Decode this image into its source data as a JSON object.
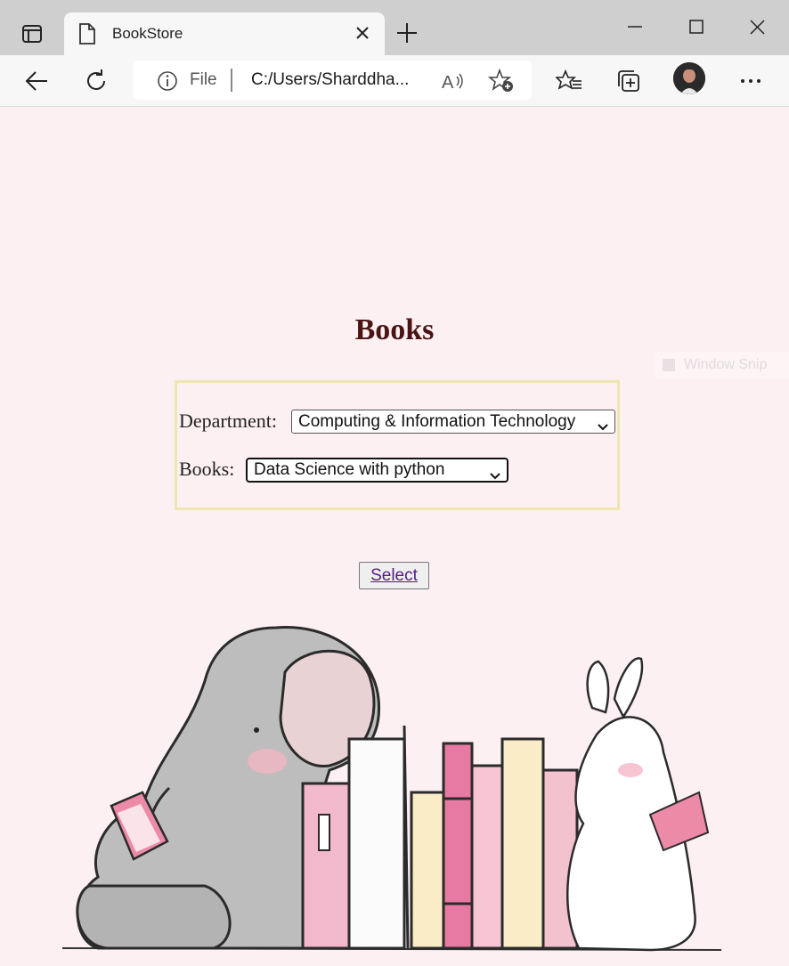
{
  "browser": {
    "tab_title": "BookStore",
    "address_scheme": "File",
    "address_url": "C:/Users/Sharddha..."
  },
  "page": {
    "heading": "Books",
    "department_label": "Department:",
    "department_value": "Computing & Information Technology",
    "books_label": "Books:",
    "books_value": "Data Science with python",
    "select_button": "Select",
    "watermark": "Window Snip"
  },
  "colors": {
    "page_bg": "#fdf0f3",
    "heading": "#4a1414",
    "form_border": "#eee6b0",
    "link": "#551a8b"
  },
  "icons": [
    "tab-actions-icon",
    "page-icon",
    "close-icon",
    "plus-icon",
    "minimize-icon",
    "maximize-icon",
    "back-icon",
    "refresh-icon",
    "info-icon",
    "read-aloud-icon",
    "add-favorite-icon",
    "favorites-icon",
    "collections-icon",
    "more-icon",
    "chevron-down-icon"
  ]
}
